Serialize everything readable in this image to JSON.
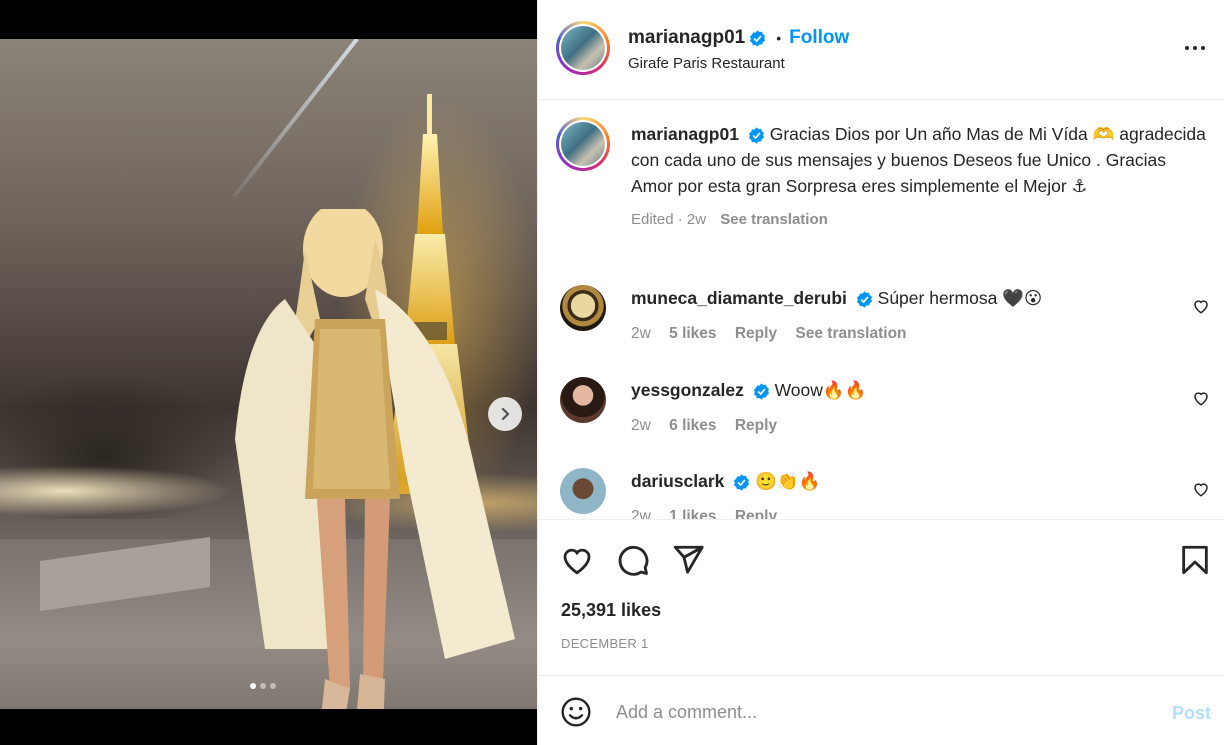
{
  "post": {
    "username": "marianagp01",
    "follow_label": "Follow",
    "separator": "•",
    "location": "Girafe Paris Restaurant",
    "caption_text": "Gracias Dios por Un año Mas de Mi Vída 🫶 agradecida con cada uno de sus mensajes y buenos Deseos fue Unico . Gracias Amor por esta gran Sorpresa eres simplemente el Mejor ⚓",
    "caption_edited": "Edited",
    "caption_age": "2w",
    "see_translation": "See translation",
    "likes": "25,391 likes",
    "date": "DECEMBER 1",
    "carousel": {
      "slide_count": 3,
      "active_index": 0
    }
  },
  "comments": [
    {
      "username": "muneca_diamante_derubi",
      "text": "Súper hermosa 🖤😮",
      "age": "2w",
      "likes": "5 likes",
      "reply": "Reply",
      "translation": "See translation"
    },
    {
      "username": "yessgonzalez",
      "text": "Woow🔥🔥",
      "age": "2w",
      "likes": "6 likes",
      "reply": "Reply"
    },
    {
      "username": "dariusclark",
      "text": "🙂👏🔥",
      "age": "2w",
      "likes": "1 likes",
      "reply": "Reply"
    }
  ],
  "composer": {
    "placeholder": "Add a comment...",
    "post_label": "Post"
  },
  "colors": {
    "link_blue": "#0095f6",
    "post_disabled": "#b2dffc",
    "muted": "#8e8e8e",
    "text": "#262626"
  },
  "icons": [
    "verified-badge-icon",
    "more-options-icon",
    "heart-icon",
    "comment-icon",
    "share-icon",
    "bookmark-icon",
    "emoji-icon",
    "chevron-right-icon"
  ]
}
